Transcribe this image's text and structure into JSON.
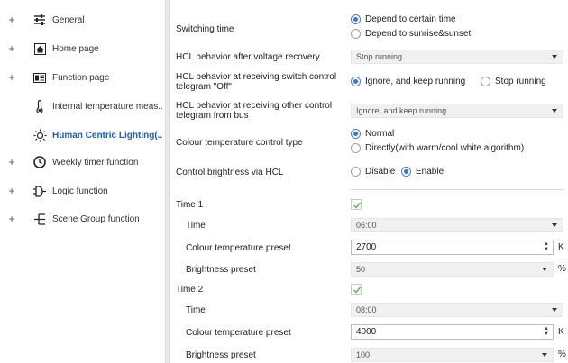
{
  "sidebar": {
    "items": [
      {
        "label": "General",
        "icon": "sliders-icon",
        "expand": "+"
      },
      {
        "label": "Home page",
        "icon": "home-icon",
        "expand": "+"
      },
      {
        "label": "Function page",
        "icon": "function-page-icon",
        "expand": "+"
      },
      {
        "label": "Internal temperature meas...",
        "icon": "thermometer-icon",
        "expand": ""
      },
      {
        "label": "Human Centric Lighting(...",
        "icon": "sun-icon",
        "expand": ""
      },
      {
        "label": "Weekly timer function",
        "icon": "clock-icon",
        "expand": "+"
      },
      {
        "label": "Logic function",
        "icon": "logic-icon",
        "expand": "+"
      },
      {
        "label": "Scene Group function",
        "icon": "scene-icon",
        "expand": "+"
      }
    ],
    "active_color": "#1a5fb4"
  },
  "main": {
    "switching_time": {
      "label": "Switching time",
      "options": [
        "Depend to certain time",
        "Depend to sunrise&sunset"
      ],
      "selected": 0
    },
    "hcl_after_recovery": {
      "label": "HCL behavior after voltage recovery",
      "value": "Stop running"
    },
    "hcl_switch_off": {
      "label_line1": "HCL behavior at receiving switch control",
      "label_line2": "telegram \"Off\"",
      "options": [
        "Ignore, and keep running",
        "Stop running"
      ],
      "selected": 0
    },
    "hcl_other_telegram": {
      "label_line1": "HCL behavior at receiving other control",
      "label_line2": "telegram from bus",
      "value": "Ignore, and keep running"
    },
    "colour_temp_control": {
      "label": "Colour temperature control type",
      "options": [
        "Normal",
        "Directly(with warm/cool white algorithm)"
      ],
      "selected": 0
    },
    "brightness_via_hcl": {
      "label": "Control brightness via HCL",
      "options": [
        "Disable",
        "Enable"
      ],
      "selected": 1
    },
    "time1": {
      "label": "Time 1",
      "checked": true,
      "time_label": "Time",
      "time_value": "06:00",
      "ct_label": "Colour temperature preset",
      "ct_value": "2700",
      "ct_unit": "K",
      "br_label": "Brightness preset",
      "br_value": "50",
      "br_unit": "%"
    },
    "time2": {
      "label": "Time 2",
      "checked": true,
      "time_label": "Time",
      "time_value": "08:00",
      "ct_label": "Colour temperature preset",
      "ct_value": "4000",
      "ct_unit": "K",
      "br_label": "Brightness preset",
      "br_value": "100",
      "br_unit": "%"
    }
  },
  "colors": {
    "radio_accent": "#3b74d1",
    "check_color": "#5cb85c",
    "select_bg": "#f0f0f0"
  }
}
